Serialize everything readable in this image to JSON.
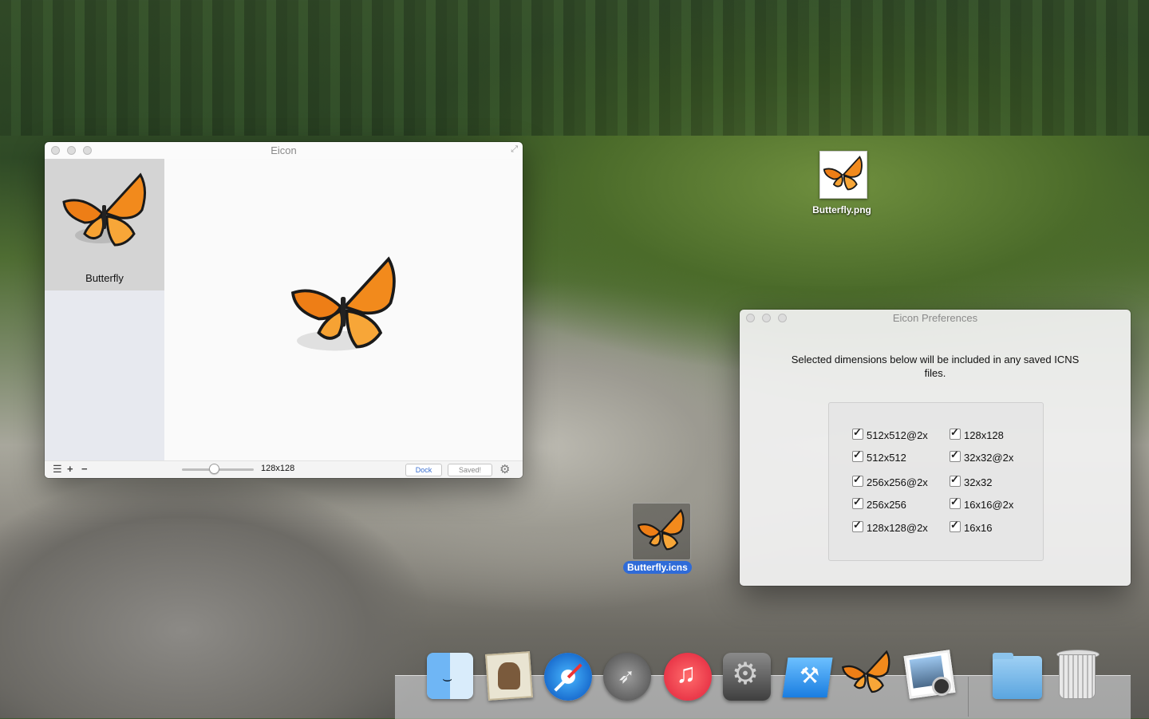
{
  "eicon_window": {
    "title": "Eicon",
    "sidebar_items": [
      {
        "label": "Butterfly"
      }
    ],
    "current_size": "128x128",
    "dock_button": "Dock",
    "saved_button": "Saved!"
  },
  "preferences_window": {
    "title": "Eicon Preferences",
    "description": "Selected dimensions below will be included in any saved ICNS files.",
    "dimensions_left": [
      "512x512@2x",
      "512x512",
      "256x256@2x",
      "256x256",
      "128x128@2x"
    ],
    "dimensions_right": [
      "128x128",
      "32x32@2x",
      "32x32",
      "16x16@2x",
      "16x16"
    ],
    "all_checked": true
  },
  "desktop_icons": [
    {
      "label": "Butterfly.png"
    },
    {
      "label": "Butterfly.icns"
    }
  ],
  "dock_items": [
    "finder-icon",
    "mail-icon",
    "safari-icon",
    "launchpad-icon",
    "itunes-icon",
    "system-preferences-icon",
    "xcode-icon",
    "eicon-app-icon",
    "iphoto-icon",
    "applications-folder-icon",
    "trash-icon"
  ]
}
